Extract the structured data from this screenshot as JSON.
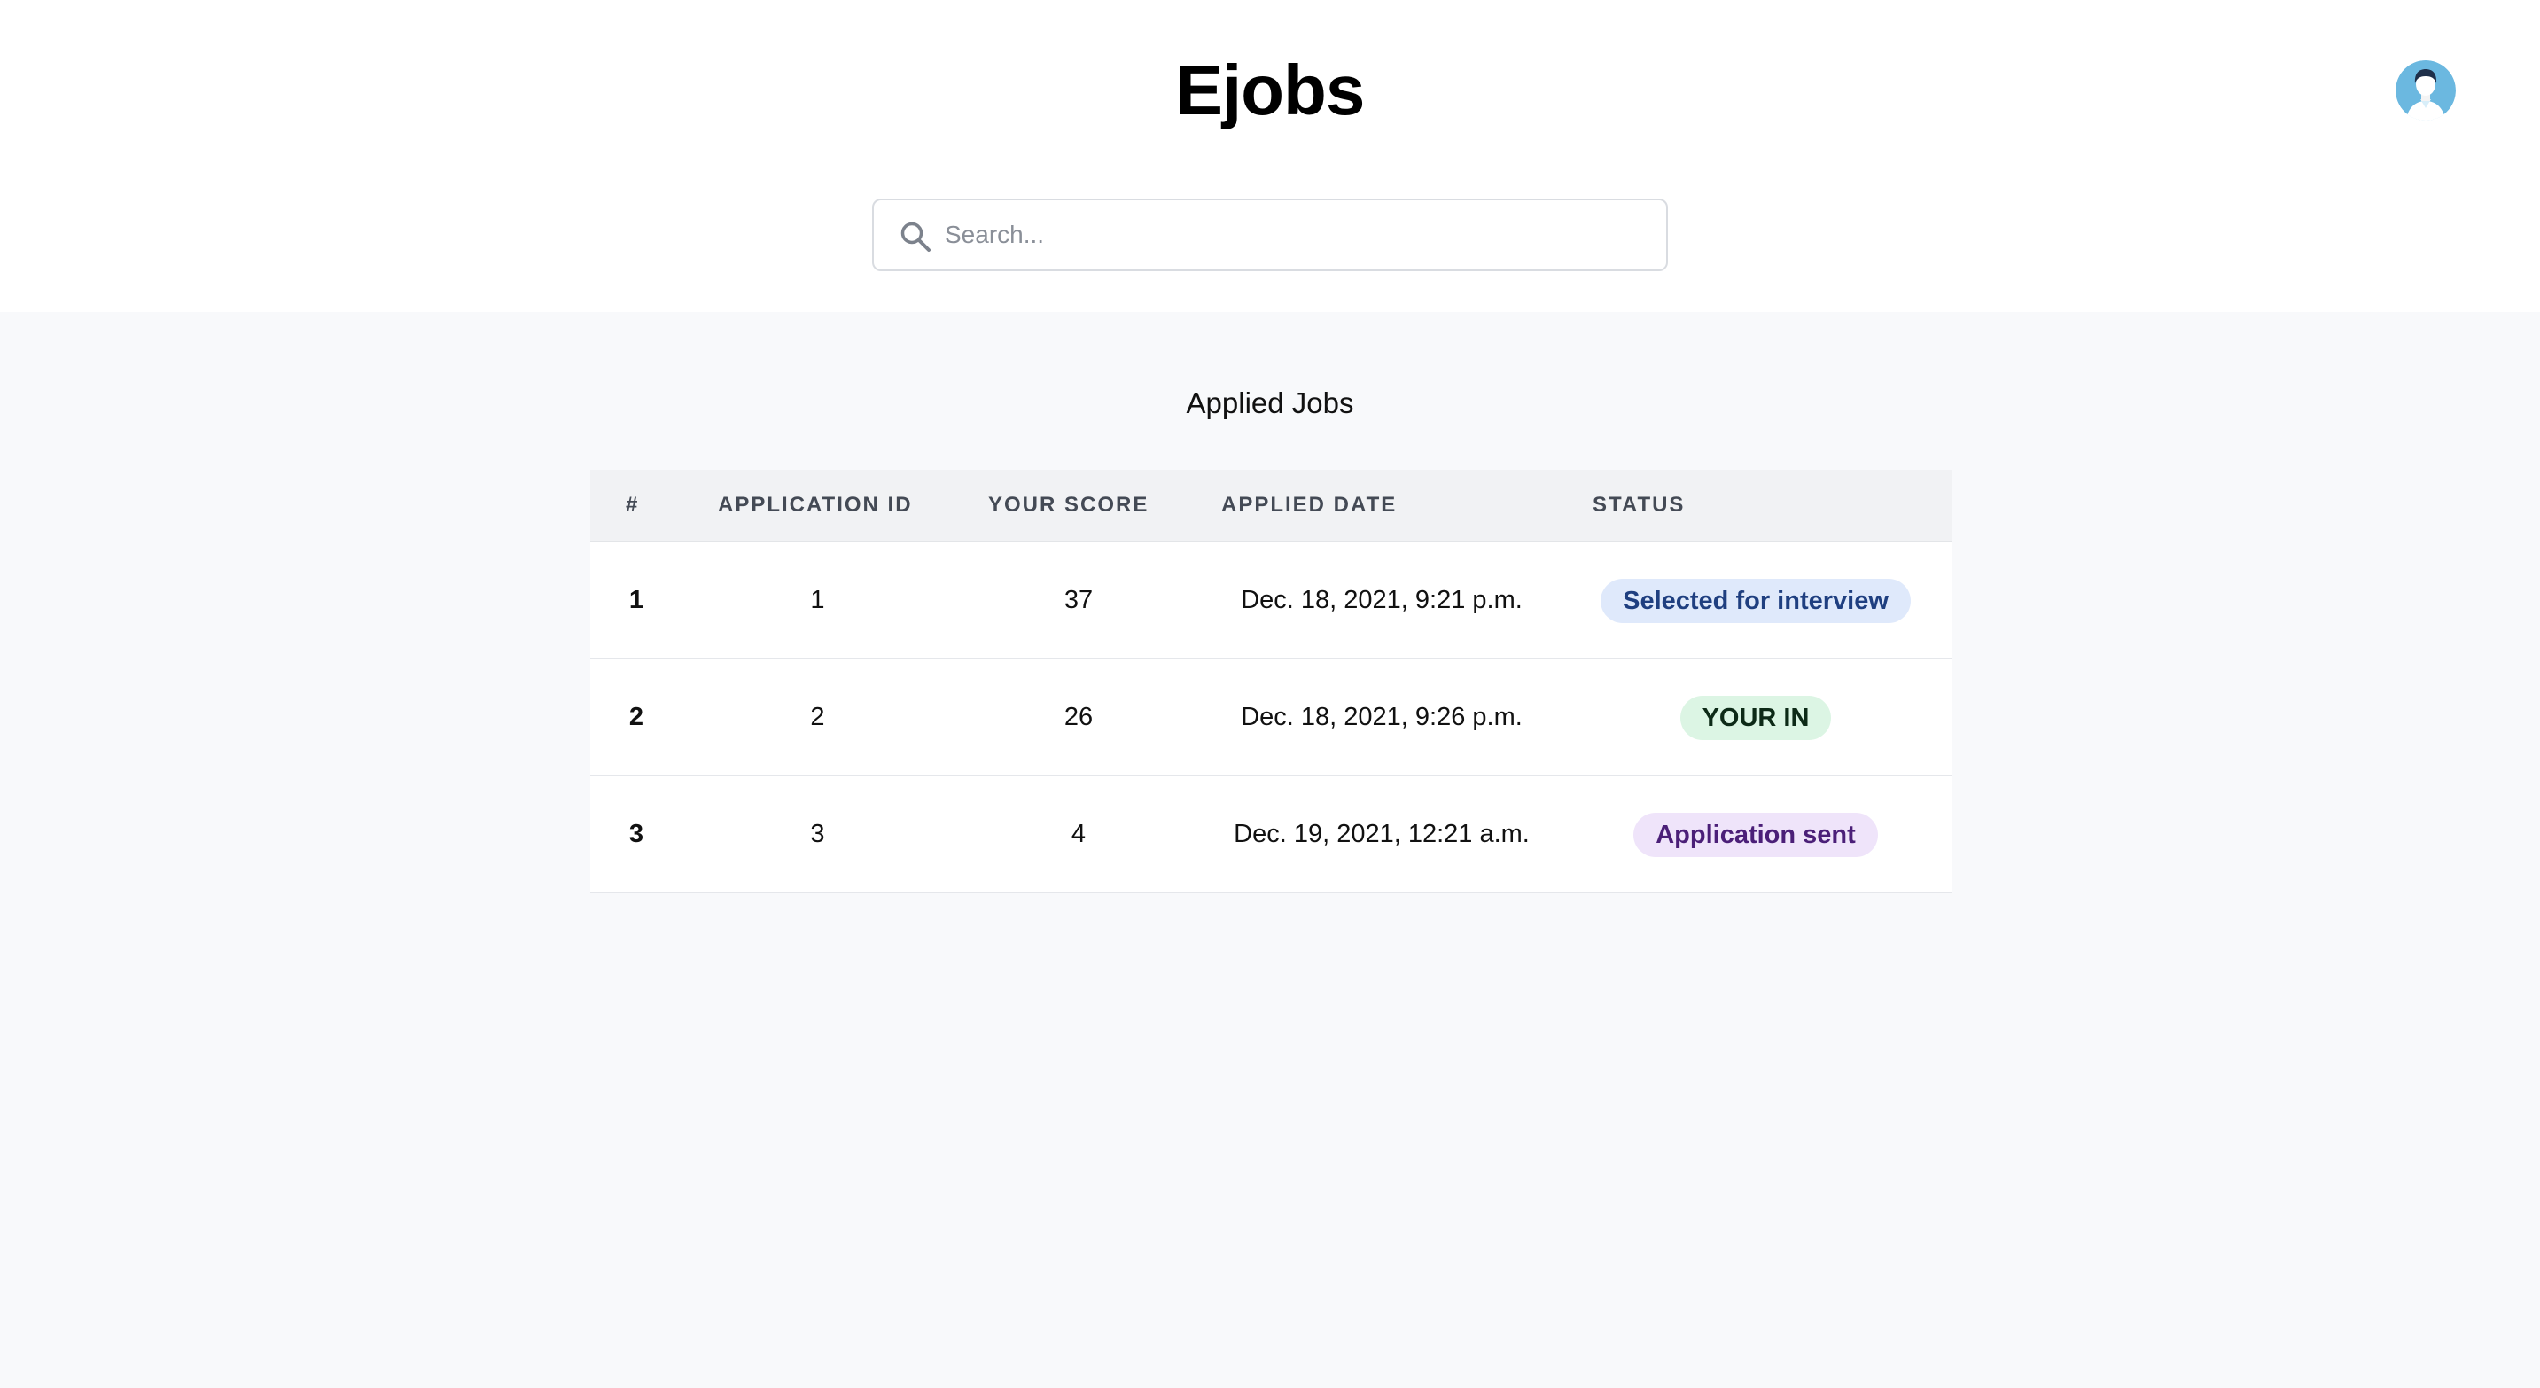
{
  "app": {
    "title": "Ejobs"
  },
  "search": {
    "placeholder": "Search..."
  },
  "section": {
    "title": "Applied Jobs"
  },
  "table": {
    "headers": [
      "#",
      "APPLICATION ID",
      "YOUR SCORE",
      "APPLIED DATE",
      "STATUS"
    ],
    "rows": [
      {
        "num": "1",
        "application_id": "1",
        "score": "37",
        "date": "Dec. 18, 2021, 9:21 p.m.",
        "status": "Selected for interview"
      },
      {
        "num": "2",
        "application_id": "2",
        "score": "26",
        "date": "Dec. 18, 2021, 9:26 p.m.",
        "status": "YOUR IN"
      },
      {
        "num": "3",
        "application_id": "3",
        "score": "4",
        "date": "Dec. 19, 2021, 12:21 a.m.",
        "status": "Application sent"
      }
    ]
  },
  "icons": {
    "search": "search-icon",
    "avatar": "user-avatar-icon"
  },
  "colors": {
    "status_selected_bg": "#dfe9fb",
    "status_selected_text": "#1f3f80",
    "status_in_bg": "#dcf5e4",
    "status_in_text": "#0d2a17",
    "status_sent_bg": "#efe4fa",
    "status_sent_text": "#4b1f78",
    "avatar_bg": "#6bb8e0"
  }
}
